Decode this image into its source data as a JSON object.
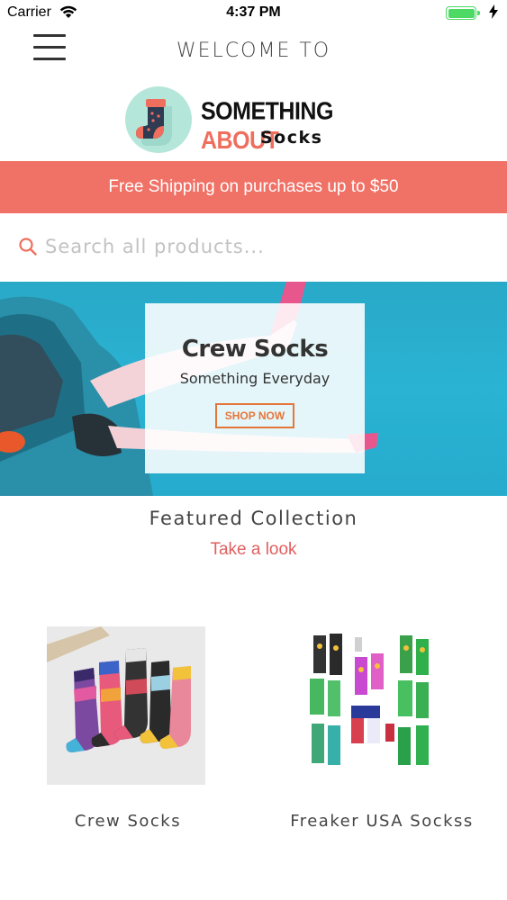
{
  "status_bar": {
    "carrier": "Carrier",
    "time": "4:37 PM",
    "battery_level": 1.0
  },
  "header": {
    "welcome_text": "WELCOME TO",
    "logo_line1_dark": "SOMETHING ",
    "logo_line1_accent": "ABOUT",
    "logo_line2": "Socks"
  },
  "promo": {
    "text": "Free Shipping on purchases up to $50"
  },
  "search": {
    "placeholder": "Search all products..."
  },
  "hero": {
    "title": "Crew Socks",
    "subtitle": "Something Everyday",
    "button_label": "SHOP NOW"
  },
  "featured": {
    "title": "Featured Collection",
    "link_label": "Take a look"
  },
  "products": [
    {
      "name": "Crew Socks"
    },
    {
      "name": "Freaker USA Sockss"
    }
  ],
  "colors": {
    "promo_bg": "#f07166",
    "accent": "#ef6e5e",
    "link": "#e06060",
    "hero_bg": "#2ab3d3",
    "shop_now": "#e5763a",
    "battery": "#4cd964"
  },
  "icons": {
    "menu": "hamburger-icon",
    "search": "search-icon",
    "wifi": "wifi-icon",
    "battery": "battery-icon",
    "charging": "charging-bolt-icon",
    "logo": "sock-logo-icon"
  }
}
